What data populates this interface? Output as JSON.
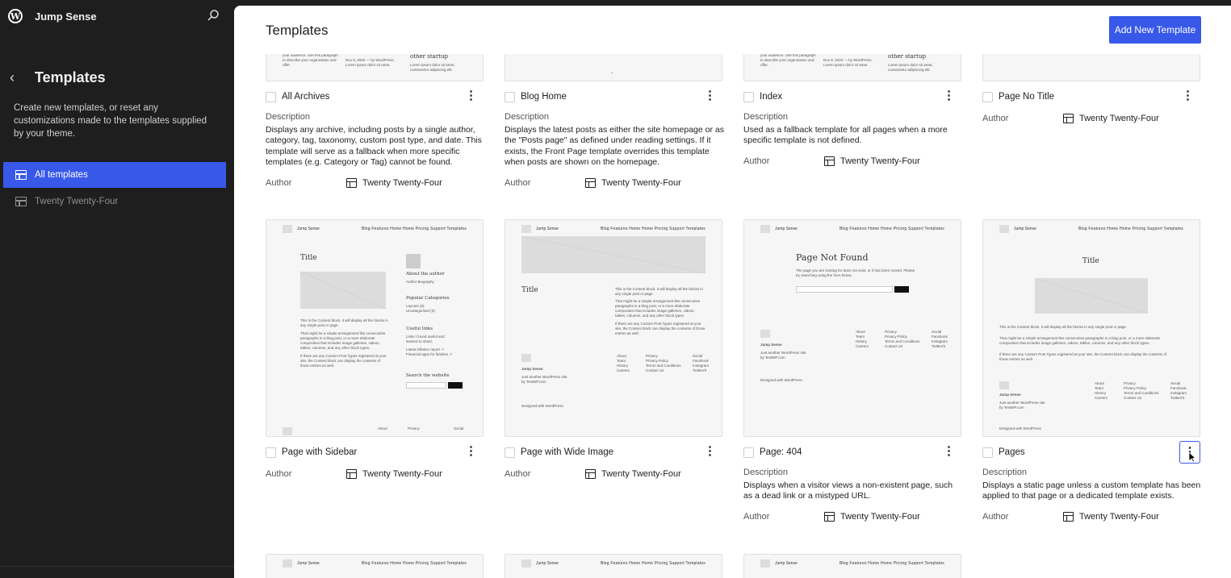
{
  "sidebar": {
    "site_name": "Jump Sense",
    "section_title": "Templates",
    "description": "Create new templates, or reset any customizations made to the templates supplied by your theme.",
    "nav": [
      {
        "label": "All templates",
        "active": true
      },
      {
        "label": "Twenty Twenty-Four",
        "active": false
      }
    ]
  },
  "header": {
    "title": "Templates",
    "add_button": "Add New Template"
  },
  "labels": {
    "description": "Description",
    "author": "Author"
  },
  "mini": {
    "site": "Jump Sense",
    "nav": "Blog  Features  Home  Home  Pricing  Support  Templates",
    "title": "Title",
    "page_not_found": "Page Not Found",
    "about_author": "About the author",
    "popular_categories": "Popular Categories",
    "useful_links": "Useful links",
    "search_website": "Search the website"
  },
  "templates": [
    {
      "title": "All Archives",
      "description": "Displays any archive, including posts by a single author, category, tag, taxonomy, custom post type, and date. This template will serve as a fallback when more specific templates (e.g. Category or Tag) cannot be found.",
      "author": "Twenty Twenty-Four"
    },
    {
      "title": "Blog Home",
      "description": "Displays the latest posts as either the site homepage or as the \"Posts page\" as defined under reading settings. If it exists, the Front Page template overrides this template when posts are shown on the homepage.",
      "author": "Twenty Twenty-Four"
    },
    {
      "title": "Index",
      "description": "Used as a fallback template for all pages when a more specific template is not defined.",
      "author": "Twenty Twenty-Four"
    },
    {
      "title": "Page No Title",
      "description": "",
      "author": "Twenty Twenty-Four"
    },
    {
      "title": "Page with Sidebar",
      "description": "",
      "author": "Twenty Twenty-Four"
    },
    {
      "title": "Page with Wide Image",
      "description": "",
      "author": "Twenty Twenty-Four"
    },
    {
      "title": "Page: 404",
      "description": "Displays when a visitor views a non-existent page, such as a dead link or a mistyped URL.",
      "author": "Twenty Twenty-Four"
    },
    {
      "title": "Pages",
      "description": "Displays a static page unless a custom template has been applied to that page or a dedicated template exists.",
      "author": "Twenty Twenty-Four"
    }
  ]
}
